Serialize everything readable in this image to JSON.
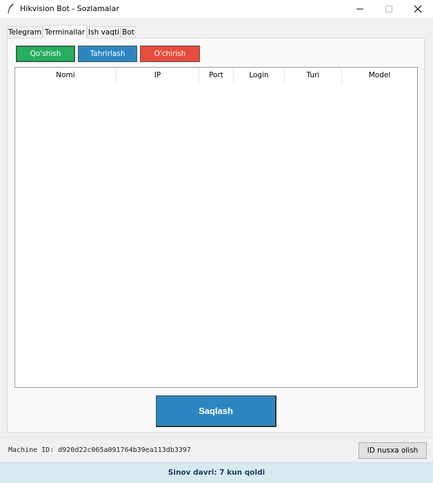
{
  "window": {
    "title": "Hikvision Bot - Sozlamalar",
    "icon": "feather-icon"
  },
  "tabs": [
    {
      "label": "Telegram",
      "active": false
    },
    {
      "label": "Terminallar",
      "active": true
    },
    {
      "label": "Ish vaqti",
      "active": false
    },
    {
      "label": "Bot",
      "active": false
    }
  ],
  "toolbar": {
    "add_label": "Qo'shish",
    "edit_label": "Tahrirlash",
    "delete_label": "O'chirish",
    "colors": {
      "add": "#27ae60",
      "edit": "#2e86c1",
      "delete": "#e74c3c"
    }
  },
  "table": {
    "columns": [
      "Nomi",
      "IP",
      "Port",
      "Login",
      "Turi",
      "Model"
    ],
    "rows": []
  },
  "save_label": "Saqlash",
  "machine_id": "Machine ID: d920d22c065a091764b39ea113db3397",
  "copy_id_label": "ID nusxa olish",
  "status": "Sinov davri: 7 kun qoldi"
}
